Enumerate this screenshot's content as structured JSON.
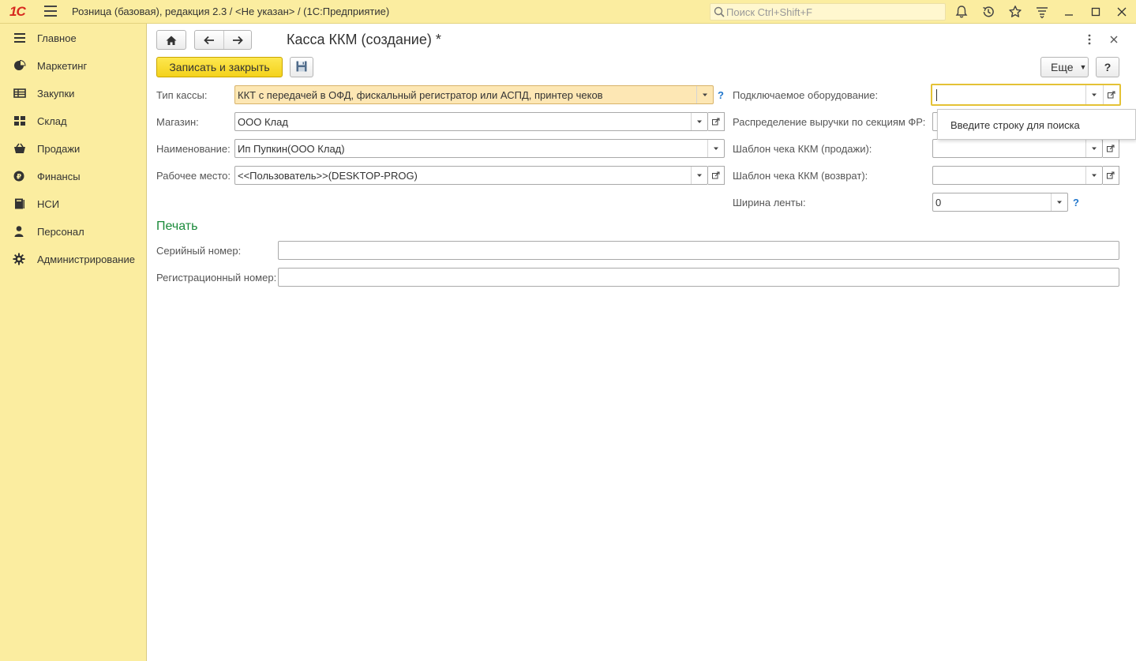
{
  "window": {
    "logo_text": "1С",
    "title": "Розница (базовая), редакция 2.3 / <Не указан> /  (1С:Предприятие)",
    "search_placeholder": "Поиск Ctrl+Shift+F"
  },
  "sidebar": {
    "items": [
      {
        "label": "Главное",
        "icon": "menu-lines-icon"
      },
      {
        "label": "Маркетинг",
        "icon": "pie-chart-icon"
      },
      {
        "label": "Закупки",
        "icon": "purchases-icon"
      },
      {
        "label": "Склад",
        "icon": "warehouse-grid-icon"
      },
      {
        "label": "Продажи",
        "icon": "basket-icon"
      },
      {
        "label": "Финансы",
        "icon": "coin-icon"
      },
      {
        "label": "НСИ",
        "icon": "book-icon"
      },
      {
        "label": "Персонал",
        "icon": "person-icon"
      },
      {
        "label": "Администрирование",
        "icon": "gear-icon"
      }
    ]
  },
  "form": {
    "title": "Касса ККМ (создание) *",
    "save_close_label": "Записать и закрыть",
    "more_label": "Еще",
    "help_label": "?",
    "left_fields": [
      {
        "label": "Тип кассы:",
        "value": "ККТ с передачей в ОФД, фискальный регистратор или АСПД, принтер чеков"
      },
      {
        "label": "Магазин:",
        "value": "ООО Клад"
      },
      {
        "label": "Наименование:",
        "value": "Ип Пупкин(ООО Клад)"
      },
      {
        "label": "Рабочее место:",
        "value": "<<Пользователь>>(DESKTOP-PROG)"
      }
    ],
    "right_fields": [
      {
        "label": "Подключаемое оборудование:",
        "value": ""
      },
      {
        "label": "Распределение выручки по секциям ФР:",
        "value": ""
      },
      {
        "label": "Шаблон чека ККМ (продажи):",
        "value": ""
      },
      {
        "label": "Шаблон чека ККМ (возврат):",
        "value": ""
      },
      {
        "label": "Ширина ленты:",
        "value": "0"
      }
    ],
    "help_mark": "?",
    "print_section": {
      "title": "Печать",
      "serial_label": "Серийный номер:",
      "serial_value": "",
      "reg_label": "Регистрационный номер:",
      "reg_value": ""
    },
    "dropdown_hint": "Введите строку для поиска"
  },
  "colors": {
    "shell_yellow": "#fbeda0",
    "primary_button": "#f4d21c",
    "highlight_field": "#fde7b4",
    "section_green": "#1a8a3a",
    "help_blue": "#2277cc",
    "logo_red": "#d7281f"
  }
}
